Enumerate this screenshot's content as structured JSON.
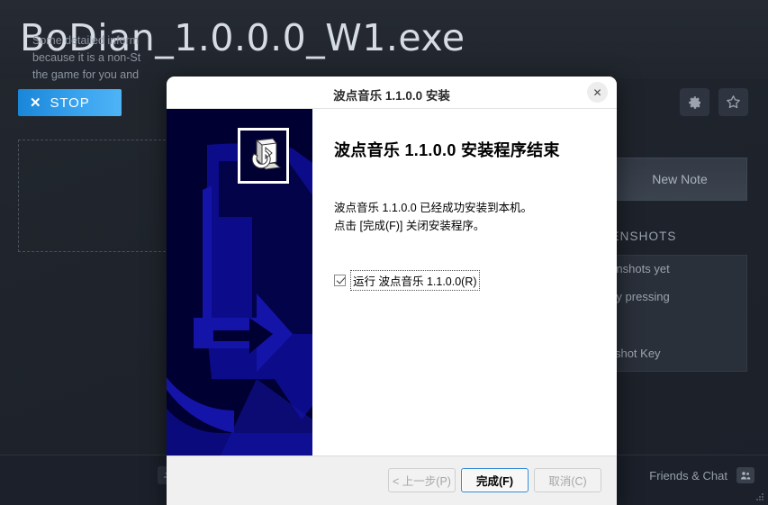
{
  "app": {
    "title": "BoDian_1.0.0.0_W1.exe",
    "stop_button": {
      "label": "STOP",
      "icon": "close-x-icon",
      "accent_color": "#3aa4ef"
    },
    "header_icons": [
      {
        "name": "gear-icon",
        "label": "Settings"
      },
      {
        "name": "star-icon",
        "label": "Favorite"
      }
    ],
    "info_box": {
      "text": "Some detailed inform\nbecause it is a non-St\nthe game for you and"
    },
    "new_note_button": "New Note",
    "screenshots": {
      "heading": "AND SCREENSHOTS",
      "empty_line1": "en any screenshots yet",
      "empty_line2": "screenshot by pressing\nme.",
      "change_key_link": "e My Screenshot Key"
    },
    "footer": {
      "download_icon": "download-icon",
      "friends_chat_label": "Friends & Chat",
      "friends_icon": "friends-icon"
    },
    "colors": {
      "background": "#1f242c",
      "panel": "#2a303a",
      "text_muted": "#9aa3ae"
    }
  },
  "installer": {
    "window_title": "波点音乐 1.1.0.0 安装",
    "close_button": "✕",
    "banner": {
      "icon_name": "nsis-install-icon",
      "background_color": "#000033",
      "graphic_color": "#0000aa"
    },
    "heading": "波点音乐 1.1.0.0 安装程序结束",
    "body": "波点音乐 1.1.0.0 已经成功安装到本机。\n点击 [完成(F)] 关闭安装程序。",
    "run_checkbox": {
      "label": "运行 波点音乐 1.1.0.0(R)",
      "checked": true
    },
    "buttons": {
      "back": {
        "label": "< 上一步(P)",
        "enabled": false
      },
      "finish": {
        "label": "完成(F)",
        "enabled": true,
        "focused": true
      },
      "cancel": {
        "label": "取消(C)",
        "enabled": false
      }
    }
  }
}
